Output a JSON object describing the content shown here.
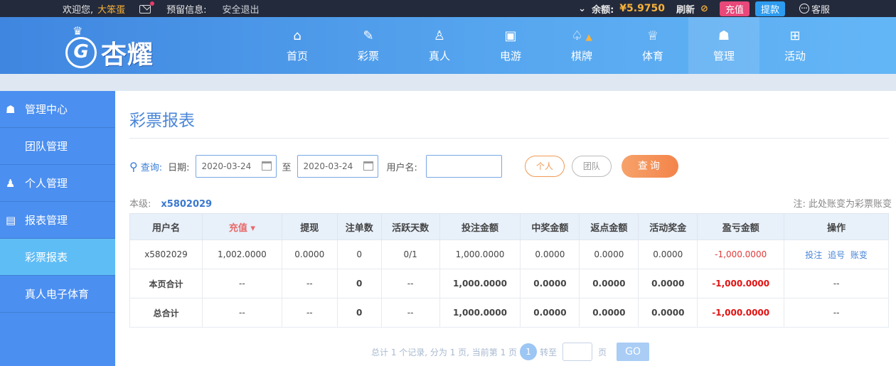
{
  "topbar": {
    "welcome": "欢迎您,",
    "username": "大笨蛋",
    "reserved_info": "预留信息:",
    "logout": "安全退出",
    "balance_label": "余额:",
    "balance_value": "¥5.9750",
    "refresh": "刷新",
    "charge": "充值",
    "withdraw": "提款",
    "service": "客服"
  },
  "logo": {
    "text": "杏耀"
  },
  "nav": [
    {
      "label": "首页",
      "icon": "home-icon"
    },
    {
      "label": "彩票",
      "icon": "ticket-icon"
    },
    {
      "label": "真人",
      "icon": "live-dealer-icon"
    },
    {
      "label": "电游",
      "icon": "slot-machine-icon"
    },
    {
      "label": "棋牌",
      "icon": "cards-icon",
      "hot": true
    },
    {
      "label": "体育",
      "icon": "trophy-icon"
    },
    {
      "label": "管理",
      "icon": "users-icon",
      "active": true
    },
    {
      "label": "活动",
      "icon": "gift-icon"
    }
  ],
  "sidebar": {
    "items": [
      {
        "label": "管理中心",
        "group": true,
        "icon": "users-icon"
      },
      {
        "label": "团队管理"
      },
      {
        "label": "个人管理",
        "group": true,
        "icon": "user-icon"
      },
      {
        "label": "报表管理",
        "group": true,
        "icon": "report-icon"
      },
      {
        "label": "彩票报表",
        "active": true
      },
      {
        "label": "真人电子体育"
      }
    ]
  },
  "main": {
    "title": "彩票报表",
    "query_label": "查询:",
    "date_label": "日期:",
    "date_from": "2020-03-24",
    "to_label": "至",
    "date_to": "2020-03-24",
    "username_label": "用户名:",
    "username_value": "",
    "personal": "个人",
    "team": "团队",
    "query_btn": "查询",
    "level_label": "本级:",
    "level_user": "x5802029",
    "note": "注: 此处账变为彩票账变"
  },
  "table": {
    "headers": [
      "用户名",
      "充值",
      "提现",
      "注单数",
      "活跃天数",
      "投注金额",
      "中奖金额",
      "返点金额",
      "活动奖金",
      "盈亏金额",
      "操作"
    ],
    "rows": [
      [
        "x5802029",
        "1,002.0000",
        "0.0000",
        "0",
        "0/1",
        "1,000.0000",
        "0.0000",
        "0.0000",
        "0.0000",
        "-1,000.0000"
      ],
      [
        "本页合计",
        "--",
        "--",
        "0",
        "--",
        "1,000.0000",
        "0.0000",
        "0.0000",
        "0.0000",
        "-1,000.0000",
        "--"
      ],
      [
        "总合计",
        "--",
        "--",
        "0",
        "--",
        "1,000.0000",
        "0.0000",
        "0.0000",
        "0.0000",
        "-1,000.0000",
        "--"
      ]
    ],
    "ops": [
      "投注",
      "追号",
      "账变"
    ]
  },
  "pager": {
    "summary": "总计 1 个记录, 分为 1 页, 当前第 1 页",
    "current": "1",
    "goto": "转至",
    "page_unit": "页",
    "go": "GO"
  }
}
